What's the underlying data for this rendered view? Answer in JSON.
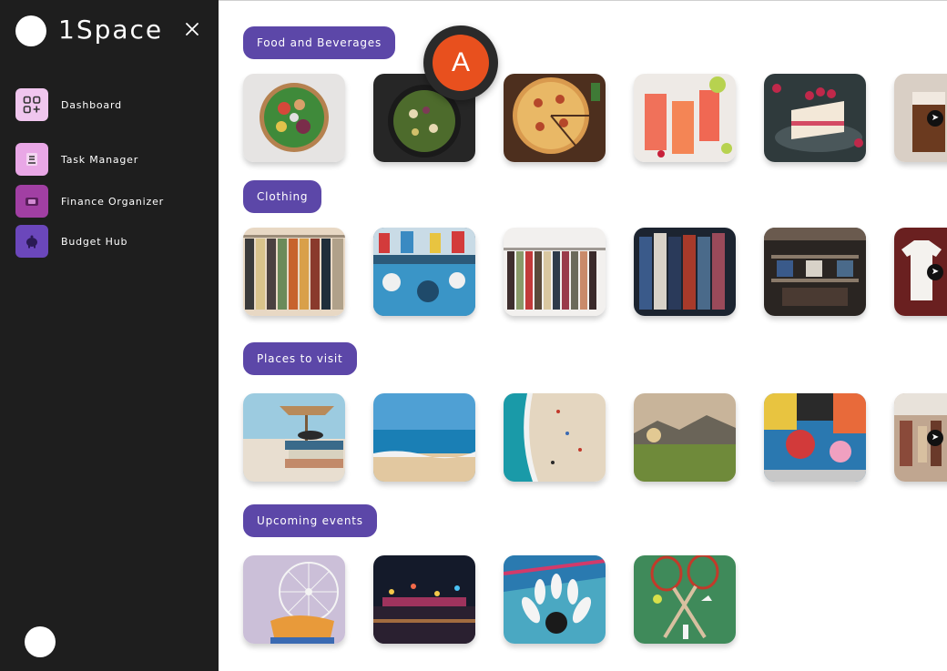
{
  "app": {
    "title": "1Space"
  },
  "sidebar": {
    "items": [
      {
        "label": "Dashboard",
        "icon": "dashboard-grid-icon",
        "color": "#f0c6ee"
      },
      {
        "label": "Task Manager",
        "icon": "task-list-icon",
        "color": "#e9a7e6"
      },
      {
        "label": "Finance Organizer",
        "icon": "wallet-icon",
        "color": "#a13fa3"
      },
      {
        "label": "Budget Hub",
        "icon": "piggy-bank-icon",
        "color": "#6b47bb"
      }
    ]
  },
  "avatar": {
    "letter": "A",
    "color": "#e8501e"
  },
  "categories": [
    {
      "label": "Food and Beverages",
      "tiles": [
        "salad-bowl",
        "dark-salad",
        "pizza",
        "red-drinks",
        "raspberry-cake",
        "iced-coffee"
      ]
    },
    {
      "label": "Clothing",
      "tiles": [
        "clothes-rack",
        "shirt-rack",
        "hangers-rack",
        "jackets-rack",
        "clothing-store",
        "white-tshirt"
      ]
    },
    {
      "label": "Places to visit",
      "tiles": [
        "beach-umbrella-books",
        "sea-shore",
        "aerial-beach",
        "mountain-meadow",
        "street-mural",
        "market-street"
      ]
    },
    {
      "label": "Upcoming events",
      "tiles": [
        "ferris-wheel",
        "carnival-night",
        "bowling-pins",
        "badminton-rackets"
      ]
    }
  ],
  "colors": {
    "accent": "#5c47a8",
    "sidebar_bg": "#1e1e1e"
  }
}
